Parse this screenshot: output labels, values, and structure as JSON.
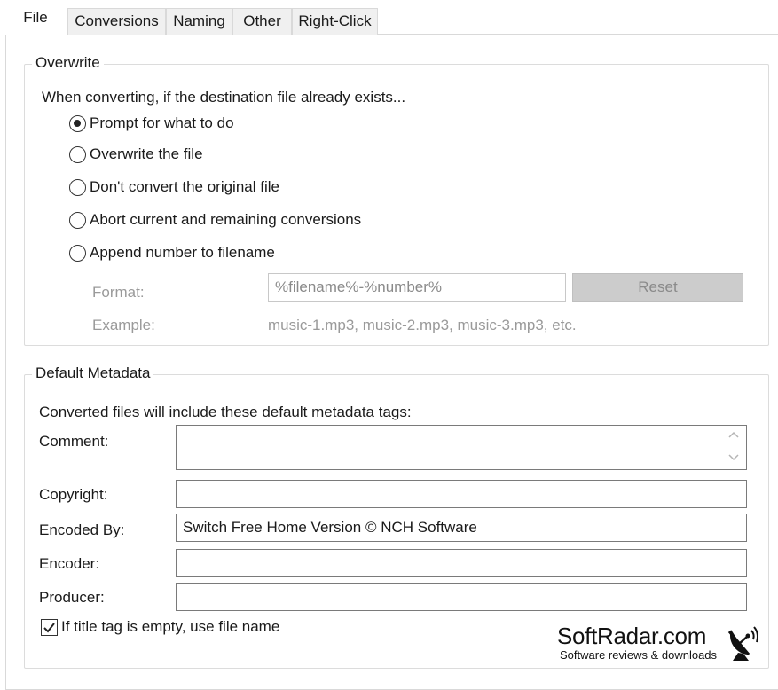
{
  "tabs": [
    {
      "label": "File",
      "active": true
    },
    {
      "label": "Conversions",
      "active": false
    },
    {
      "label": "Naming",
      "active": false
    },
    {
      "label": "Other",
      "active": false
    },
    {
      "label": "Right-Click",
      "active": false
    }
  ],
  "overwrite": {
    "legend": "Overwrite",
    "prompt": "When converting, if the destination file already exists...",
    "options": [
      {
        "label": "Prompt for what to do",
        "selected": true
      },
      {
        "label": "Overwrite the file",
        "selected": false
      },
      {
        "label": "Don't convert the original file",
        "selected": false
      },
      {
        "label": "Abort current and remaining conversions",
        "selected": false
      },
      {
        "label": "Append number to filename",
        "selected": false
      }
    ],
    "format_label": "Format:",
    "format_value": "%filename%-%number%",
    "reset_label": "Reset",
    "example_label": "Example:",
    "example_value": "music-1.mp3, music-2.mp3, music-3.mp3, etc."
  },
  "metadata": {
    "legend": "Default Metadata",
    "intro": "Converted files will include these default metadata tags:",
    "comment_label": "Comment:",
    "comment_value": "",
    "copyright_label": "Copyright:",
    "copyright_value": "",
    "encoded_by_label": "Encoded By:",
    "encoded_by_value": "Switch Free Home Version © NCH Software",
    "encoder_label": "Encoder:",
    "encoder_value": "",
    "producer_label": "Producer:",
    "producer_value": "",
    "title_checkbox_label": "If title tag is empty, use file name",
    "title_checkbox_checked": true
  },
  "watermark": {
    "brand": "SoftRadar.com",
    "tagline": "Software reviews & downloads"
  },
  "icons": {
    "scroll_up": "chevron-up-icon",
    "scroll_down": "chevron-down-icon",
    "check": "checkmark-icon",
    "satellite": "satellite-dish-icon"
  }
}
